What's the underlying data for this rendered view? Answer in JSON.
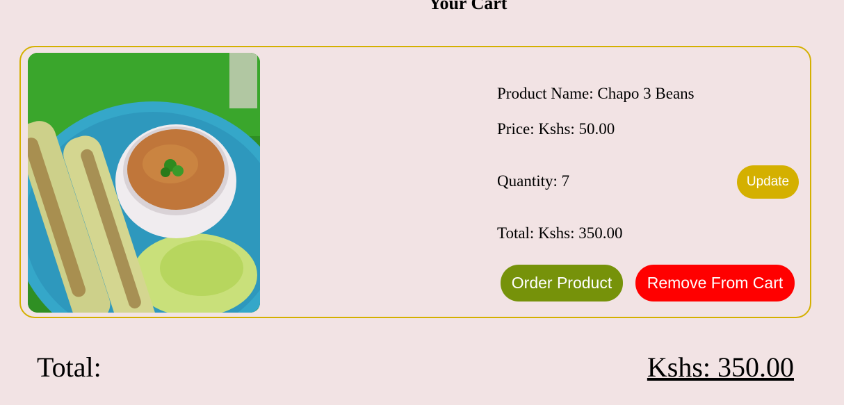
{
  "page": {
    "title": "Your Cart"
  },
  "cart": {
    "items": [
      {
        "image_alt": "Chapo 3 Beans",
        "name_text": "Product Name: Chapo 3 Beans",
        "price_text": "Price: Kshs: 50.00",
        "quantity_text": "Quantity: 7",
        "total_text": "Total: Kshs: 350.00",
        "update_label": "Update",
        "order_label": "Order Product",
        "remove_label": "Remove From Cart"
      }
    ]
  },
  "summary": {
    "label": "Total:",
    "value": "Kshs: 350.00"
  },
  "colors": {
    "background": "#f2e3e4",
    "card_border": "#d4b000",
    "update_button": "#d4b000",
    "order_button": "#76920a",
    "remove_button": "#ff0000"
  }
}
